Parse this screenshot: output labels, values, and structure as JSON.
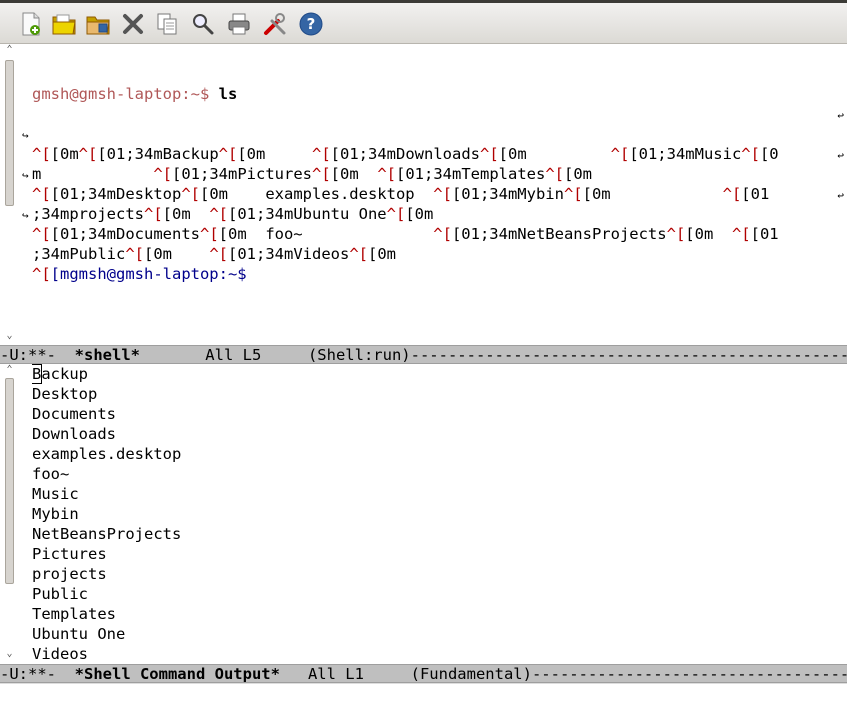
{
  "toolbar": {
    "buttons": [
      {
        "name": "new-file",
        "icon": "new-file-icon"
      },
      {
        "name": "open-file",
        "icon": "folder-open-icon"
      },
      {
        "name": "open-directory",
        "icon": "folder-directory-icon"
      },
      {
        "name": "close-buffer",
        "icon": "close-icon"
      },
      {
        "name": "copy",
        "icon": "copy-icon"
      },
      {
        "name": "search",
        "icon": "search-icon"
      },
      {
        "name": "print",
        "icon": "print-icon"
      },
      {
        "name": "customize",
        "icon": "tools-icon"
      },
      {
        "name": "help",
        "icon": "help-icon"
      }
    ]
  },
  "shell": {
    "prompt": "gmsh@gmsh-laptop:~$ ",
    "command": "ls",
    "lines": [
      [
        {
          "t": "^[",
          "c": "esc"
        },
        {
          "t": "[0m"
        },
        {
          "t": "^[",
          "c": "esc"
        },
        {
          "t": "[01;34mBackup"
        },
        {
          "t": "^[",
          "c": "esc"
        },
        {
          "t": "[0m     "
        },
        {
          "t": "^[",
          "c": "esc"
        },
        {
          "t": "[01;34mDownloads"
        },
        {
          "t": "^[",
          "c": "esc"
        },
        {
          "t": "[0m         "
        },
        {
          "t": "^[",
          "c": "esc"
        },
        {
          "t": "[01;34mMusic"
        },
        {
          "t": "^[",
          "c": "esc"
        },
        {
          "t": "[0"
        }
      ],
      [
        {
          "t": "m            "
        },
        {
          "t": "^[",
          "c": "esc"
        },
        {
          "t": "[01;34mPictures"
        },
        {
          "t": "^[",
          "c": "esc"
        },
        {
          "t": "[0m  "
        },
        {
          "t": "^[",
          "c": "esc"
        },
        {
          "t": "[01;34mTemplates"
        },
        {
          "t": "^[",
          "c": "esc"
        },
        {
          "t": "[0m"
        }
      ],
      [
        {
          "t": "^[",
          "c": "esc"
        },
        {
          "t": "[01;34mDesktop"
        },
        {
          "t": "^[",
          "c": "esc"
        },
        {
          "t": "[0m    examples.desktop  "
        },
        {
          "t": "^[",
          "c": "esc"
        },
        {
          "t": "[01;34mMybin"
        },
        {
          "t": "^[",
          "c": "esc"
        },
        {
          "t": "[0m            "
        },
        {
          "t": "^[",
          "c": "esc"
        },
        {
          "t": "[01"
        }
      ],
      [
        {
          "t": ";34mprojects"
        },
        {
          "t": "^[",
          "c": "esc"
        },
        {
          "t": "[0m  "
        },
        {
          "t": "^[",
          "c": "esc"
        },
        {
          "t": "[01;34mUbuntu One"
        },
        {
          "t": "^[",
          "c": "esc"
        },
        {
          "t": "[0m"
        }
      ],
      [
        {
          "t": "^[",
          "c": "esc"
        },
        {
          "t": "[01;34mDocuments"
        },
        {
          "t": "^[",
          "c": "esc"
        },
        {
          "t": "[0m  foo~              "
        },
        {
          "t": "^[",
          "c": "esc"
        },
        {
          "t": "[01;34mNetBeansProjects"
        },
        {
          "t": "^[",
          "c": "esc"
        },
        {
          "t": "[0m  "
        },
        {
          "t": "^[",
          "c": "esc"
        },
        {
          "t": "[01"
        }
      ],
      [
        {
          "t": ";34mPublic"
        },
        {
          "t": "^[",
          "c": "esc"
        },
        {
          "t": "[0m    "
        },
        {
          "t": "^[",
          "c": "esc"
        },
        {
          "t": "[01;34mVideos"
        },
        {
          "t": "^[",
          "c": "esc"
        },
        {
          "t": "[0m"
        }
      ]
    ],
    "last_prompt_prefix": "^[",
    "last_prompt": "[mgmsh@gmsh-laptop:~$"
  },
  "modeline1": {
    "flags": "-U:**-  ",
    "buffer": "*shell*",
    "position": "       All L5     ",
    "mode": "(Shell:run)",
    "fill": "------------------------------------------------------------------"
  },
  "output": {
    "items": [
      "Backup",
      "Desktop",
      "Documents",
      "Downloads",
      "examples.desktop",
      "foo~",
      "Music",
      "Mybin",
      "NetBeansProjects",
      "Pictures",
      "projects",
      "Public",
      "Templates",
      "Ubuntu One",
      "Videos"
    ]
  },
  "modeline2": {
    "flags": "-U:**-  ",
    "buffer": "*Shell Command Output*",
    "position": "   All L1     ",
    "mode": "(Fundamental)",
    "fill": "------------------------------------------------------------------"
  },
  "colors": {
    "prompt": "#b05858",
    "escape": "#b00000",
    "prompt_blue": "#00008b",
    "modeline_bg": "#bfbfbf"
  }
}
